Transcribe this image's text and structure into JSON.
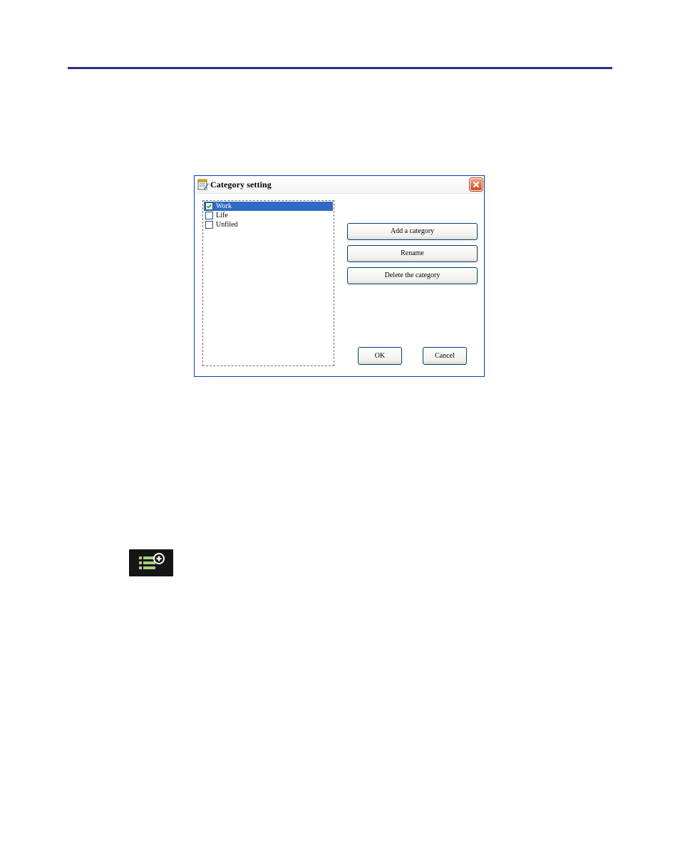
{
  "dialog": {
    "title": "Category setting",
    "icons": {
      "app": "notepad-icon",
      "close": "close-icon"
    },
    "categories": [
      {
        "label": "Work",
        "checked": true,
        "selected": true
      },
      {
        "label": "Life",
        "checked": false,
        "selected": false
      },
      {
        "label": "Unfiled",
        "checked": false,
        "selected": false
      }
    ],
    "buttons": {
      "add": "Add a category",
      "rename": "Rename",
      "delete": "Delete the category",
      "ok": "OK",
      "cancel": "Cancel"
    }
  },
  "toolbar_icon": {
    "name": "add-category-icon",
    "colors": {
      "background": "#151515",
      "lines": "#a9cf7c",
      "plus_circle": "#ffffff"
    }
  },
  "colors": {
    "rule": "#2b2f86",
    "selection": "#316ac5",
    "dialog_border": "#0a3fb8",
    "close_button": "#d24a1f"
  }
}
